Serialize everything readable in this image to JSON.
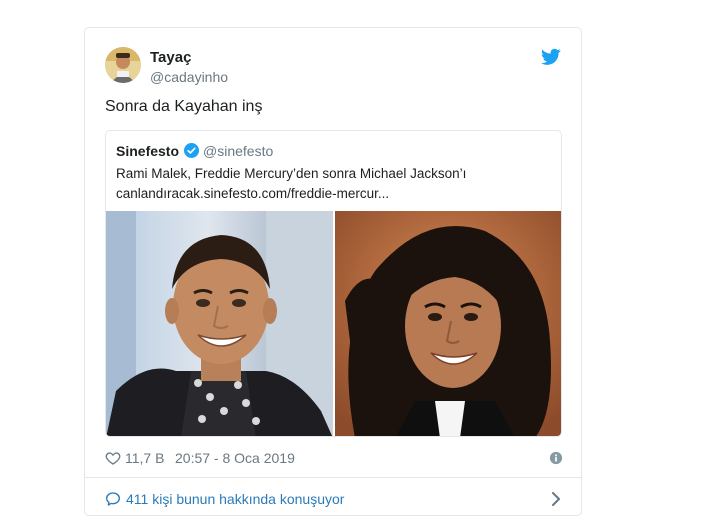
{
  "tweet": {
    "author_name": "Tayaç",
    "author_handle": "@cadayinho",
    "text": "Sonra da Kayahan inş",
    "likes": "11,7 B",
    "timestamp": "20:57 - 8 Oca 2019",
    "conversation": "411 kişi bunun hakkında konuşuyor"
  },
  "quoted": {
    "name": "Sinefesto",
    "handle": "@sinefesto",
    "text_line1": "Rami Malek, Freddie Mercury’den sonra Michael Jackson’ı",
    "text_line2": "canlandıracak.sinefesto.com/freddie-mercur..."
  },
  "icons": {
    "twitter": "twitter-bird-icon",
    "verified": "verified-badge-icon",
    "heart": "heart-icon",
    "info": "info-icon",
    "speech": "speech-bubble-icon",
    "chevron": "chevron-right-icon"
  },
  "colors": {
    "twitter_blue": "#1da1f2",
    "link_blue": "#2b7bb9",
    "muted": "#697882",
    "text": "#1c2022",
    "border": "#e1e8ed"
  }
}
